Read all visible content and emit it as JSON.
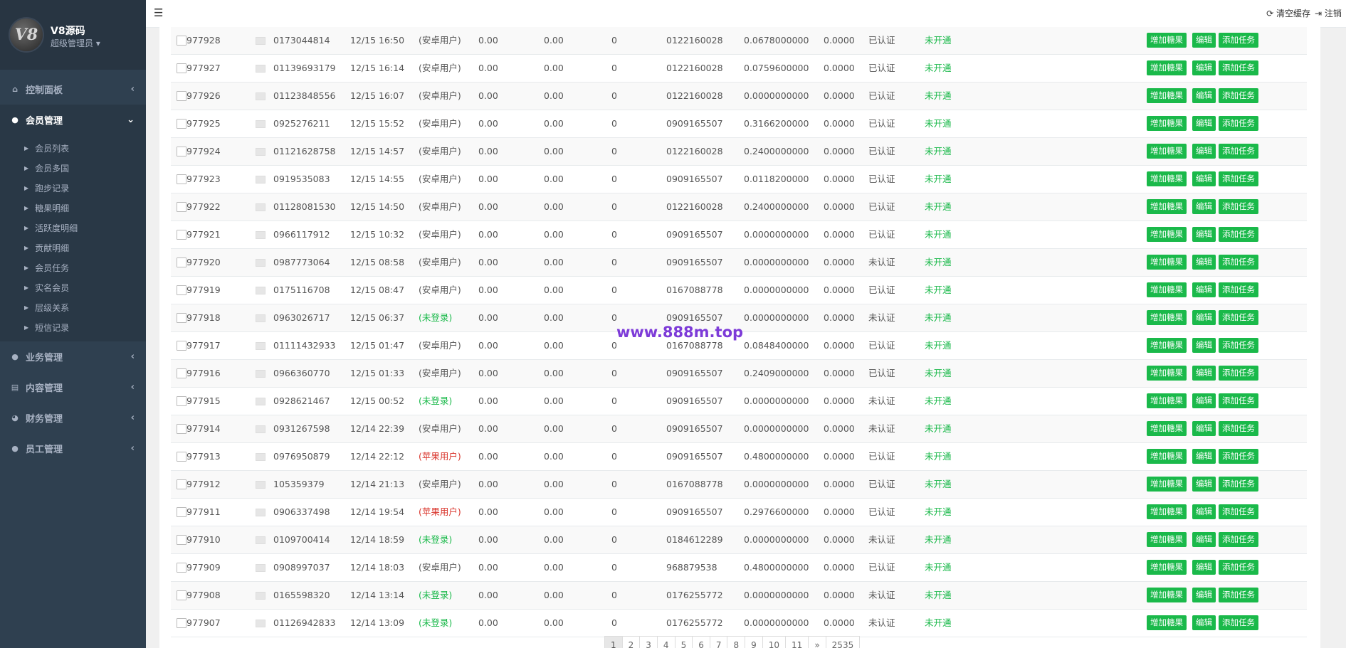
{
  "sidebar": {
    "site_name": "V8源码",
    "role": "超级管理员 ▾",
    "logo_text": "V8",
    "menu": [
      {
        "label": "控制面板",
        "icon": "home-icon",
        "arrow": "‹"
      },
      {
        "label": "会员管理",
        "icon": "user-icon",
        "arrow": "⌄"
      },
      {
        "label": "业务管理",
        "icon": "user-icon",
        "arrow": "‹"
      },
      {
        "label": "内容管理",
        "icon": "book-icon",
        "arrow": "‹"
      },
      {
        "label": "财务管理",
        "icon": "pie-chart-icon",
        "arrow": "‹"
      },
      {
        "label": "员工管理",
        "icon": "user-icon",
        "arrow": "‹"
      }
    ],
    "submenu": [
      "会员列表",
      "会员多国",
      "跑步记录",
      "糖果明细",
      "活跃度明细",
      "贡献明细",
      "会员任务",
      "实名会员",
      "层级关系",
      "短信记录"
    ]
  },
  "topbar": {
    "clear_cache": "⟳ 清空缓存",
    "logout": "⇥ 注销"
  },
  "buttons": {
    "add_candy": "增加糖果",
    "edit": "编辑",
    "add_task": "添加任务"
  },
  "rows": [
    [
      "977928",
      "0173044814",
      "12/15 16:50",
      "(安卓用户)",
      "0.00",
      "0.00",
      "0",
      "0122160028",
      "0.0678000000",
      "0.0000",
      "已认证",
      "未开通"
    ],
    [
      "977927",
      "01139693179",
      "12/15 16:14",
      "(安卓用户)",
      "0.00",
      "0.00",
      "0",
      "0122160028",
      "0.0759600000",
      "0.0000",
      "已认证",
      "未开通"
    ],
    [
      "977926",
      "01123848556",
      "12/15 16:07",
      "(安卓用户)",
      "0.00",
      "0.00",
      "0",
      "0122160028",
      "0.0000000000",
      "0.0000",
      "已认证",
      "未开通"
    ],
    [
      "977925",
      "0925276211",
      "12/15 15:52",
      "(安卓用户)",
      "0.00",
      "0.00",
      "0",
      "0909165507",
      "0.3166200000",
      "0.0000",
      "已认证",
      "未开通"
    ],
    [
      "977924",
      "01121628758",
      "12/15 14:57",
      "(安卓用户)",
      "0.00",
      "0.00",
      "0",
      "0122160028",
      "0.2400000000",
      "0.0000",
      "已认证",
      "未开通"
    ],
    [
      "977923",
      "0919535083",
      "12/15 14:55",
      "(安卓用户)",
      "0.00",
      "0.00",
      "0",
      "0909165507",
      "0.0118200000",
      "0.0000",
      "已认证",
      "未开通"
    ],
    [
      "977922",
      "01128081530",
      "12/15 14:50",
      "(安卓用户)",
      "0.00",
      "0.00",
      "0",
      "0122160028",
      "0.2400000000",
      "0.0000",
      "已认证",
      "未开通"
    ],
    [
      "977921",
      "0966117912",
      "12/15 10:32",
      "(安卓用户)",
      "0.00",
      "0.00",
      "0",
      "0909165507",
      "0.0000000000",
      "0.0000",
      "已认证",
      "未开通"
    ],
    [
      "977920",
      "0987773064",
      "12/15 08:58",
      "(安卓用户)",
      "0.00",
      "0.00",
      "0",
      "0909165507",
      "0.0000000000",
      "0.0000",
      "未认证",
      "未开通"
    ],
    [
      "977919",
      "0175116708",
      "12/15 08:47",
      "(安卓用户)",
      "0.00",
      "0.00",
      "0",
      "0167088778",
      "0.0000000000",
      "0.0000",
      "已认证",
      "未开通"
    ],
    [
      "977918",
      "0963026717",
      "12/15 06:37",
      "(未登录)",
      "0.00",
      "0.00",
      "0",
      "0909165507",
      "0.0000000000",
      "0.0000",
      "未认证",
      "未开通"
    ],
    [
      "977917",
      "01111432933",
      "12/15 01:47",
      "(安卓用户)",
      "0.00",
      "0.00",
      "0",
      "0167088778",
      "0.0848400000",
      "0.0000",
      "已认证",
      "未开通"
    ],
    [
      "977916",
      "0966360770",
      "12/15 01:33",
      "(安卓用户)",
      "0.00",
      "0.00",
      "0",
      "0909165507",
      "0.2409000000",
      "0.0000",
      "已认证",
      "未开通"
    ],
    [
      "977915",
      "0928621467",
      "12/15 00:52",
      "(未登录)",
      "0.00",
      "0.00",
      "0",
      "0909165507",
      "0.0000000000",
      "0.0000",
      "未认证",
      "未开通"
    ],
    [
      "977914",
      "0931267598",
      "12/14 22:39",
      "(安卓用户)",
      "0.00",
      "0.00",
      "0",
      "0909165507",
      "0.0000000000",
      "0.0000",
      "未认证",
      "未开通"
    ],
    [
      "977913",
      "0976950879",
      "12/14 22:12",
      "(苹果用户)",
      "0.00",
      "0.00",
      "0",
      "0909165507",
      "0.4800000000",
      "0.0000",
      "已认证",
      "未开通"
    ],
    [
      "977912",
      "105359379",
      "12/14 21:13",
      "(安卓用户)",
      "0.00",
      "0.00",
      "0",
      "0167088778",
      "0.0000000000",
      "0.0000",
      "已认证",
      "未开通"
    ],
    [
      "977911",
      "0906337498",
      "12/14 19:54",
      "(苹果用户)",
      "0.00",
      "0.00",
      "0",
      "0909165507",
      "0.2976600000",
      "0.0000",
      "已认证",
      "未开通"
    ],
    [
      "977910",
      "0109700414",
      "12/14 18:59",
      "(未登录)",
      "0.00",
      "0.00",
      "0",
      "0184612289",
      "0.0000000000",
      "0.0000",
      "未认证",
      "未开通"
    ],
    [
      "977909",
      "0908997037",
      "12/14 18:03",
      "(安卓用户)",
      "0.00",
      "0.00",
      "0",
      "968879538",
      "0.4800000000",
      "0.0000",
      "已认证",
      "未开通"
    ],
    [
      "977908",
      "0165598320",
      "12/14 13:14",
      "(未登录)",
      "0.00",
      "0.00",
      "0",
      "0176255772",
      "0.0000000000",
      "0.0000",
      "未认证",
      "未开通"
    ],
    [
      "977907",
      "01126942833",
      "12/14 13:09",
      "(未登录)",
      "0.00",
      "0.00",
      "0",
      "0176255772",
      "0.0000000000",
      "0.0000",
      "未认证",
      "未开通"
    ]
  ],
  "pagination": [
    "1",
    "2",
    "3",
    "4",
    "5",
    "6",
    "7",
    "8",
    "9",
    "10",
    "11",
    "»",
    "2535"
  ],
  "watermark": "www.888m.top",
  "colors": {
    "sidebar_bg": "#2f4050",
    "button_green": "#1ab94a",
    "status_green": "#1ab94a",
    "ios_red": "#d9342b",
    "watermark_purple": "#7d3bd8"
  }
}
